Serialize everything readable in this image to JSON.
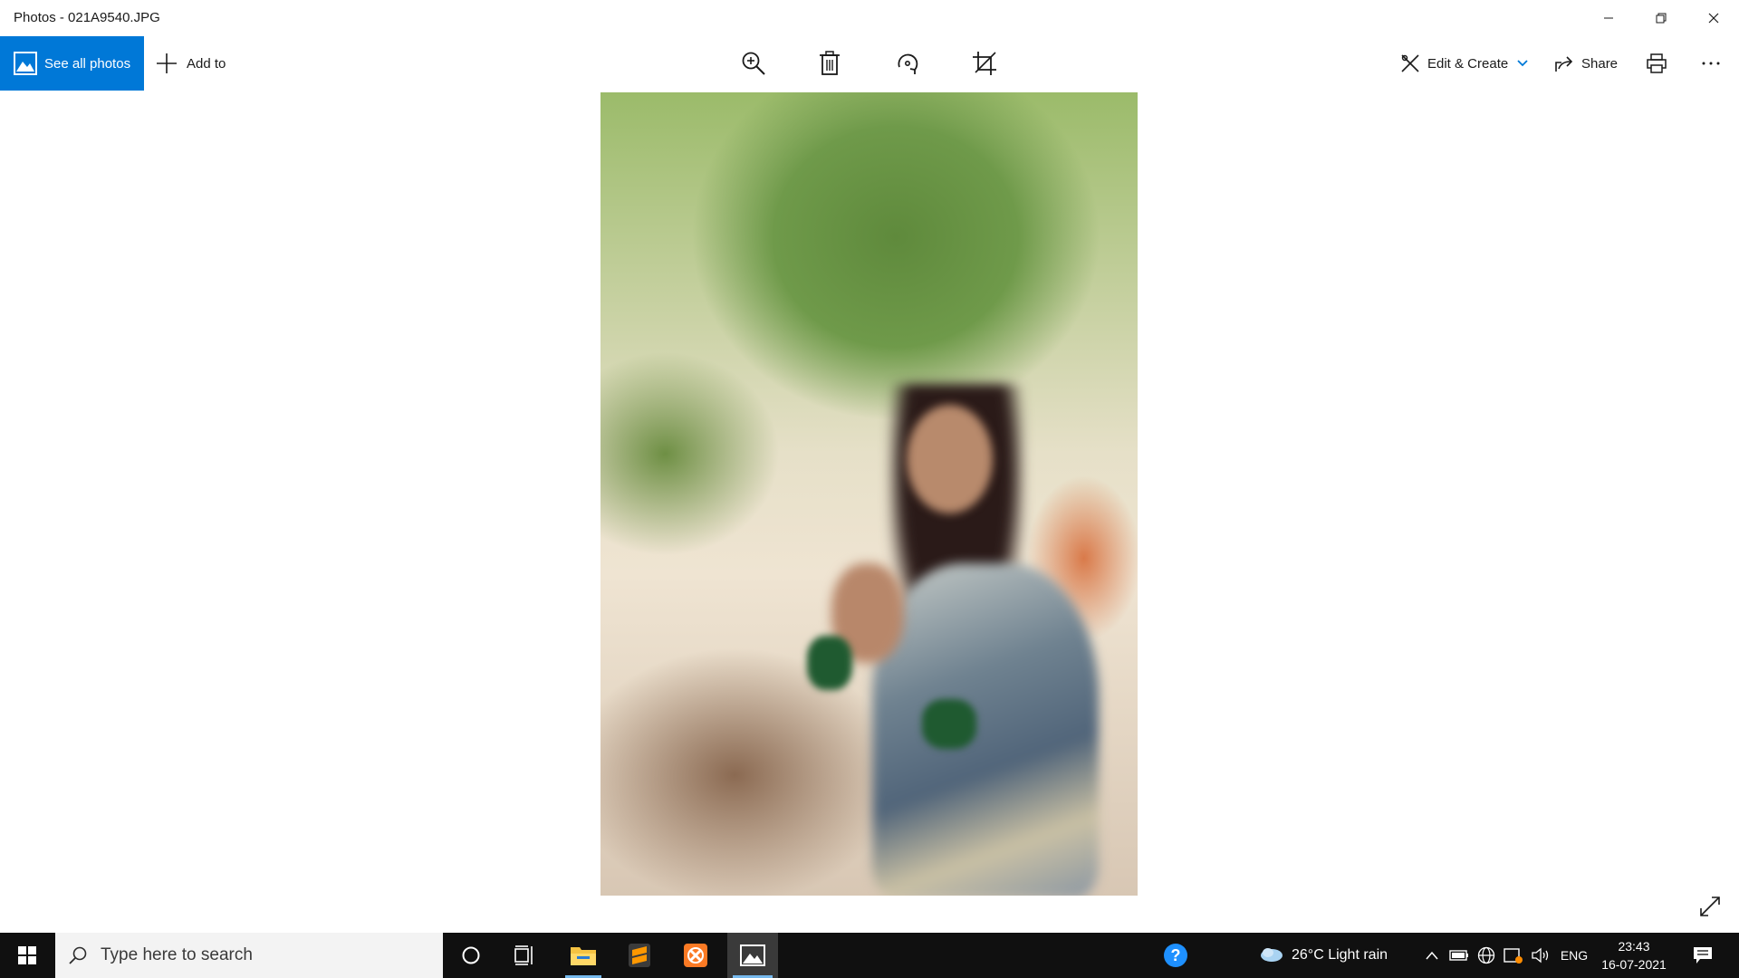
{
  "window": {
    "title": "Photos - 021A9540.JPG",
    "controls": [
      "minimize",
      "restore",
      "close"
    ]
  },
  "toolbar": {
    "see_all_label": "See all photos",
    "add_to_label": "Add to",
    "tools": [
      "zoom-icon",
      "delete-icon",
      "rotate-icon",
      "crop-icon"
    ],
    "edit_create_label": "Edit & Create",
    "share_label": "Share",
    "accent_color": "#0078d7"
  },
  "taskbar": {
    "search_placeholder": "Type here to search",
    "weather": "26°C  Light rain",
    "language": "ENG",
    "time": "23:43",
    "date": "16-07-2021"
  }
}
